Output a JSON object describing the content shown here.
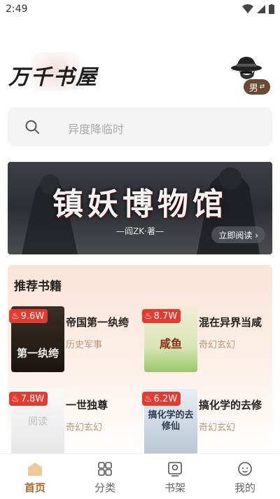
{
  "status_bar": {
    "time": "2:49"
  },
  "header": {
    "logo_text": "万千书屋",
    "gender_label": "男"
  },
  "search": {
    "placeholder": "异度降临时"
  },
  "banner": {
    "title": "镇妖博物馆",
    "author": "—阎ZK·著—",
    "read_button": "立即阅读 ›"
  },
  "recommend": {
    "title": "推荐书籍",
    "books": [
      {
        "name": "帝国第一纨绔",
        "genre": "历史军事",
        "heat": "9.6W",
        "cover_text": "第一纨绔"
      },
      {
        "name": "混在异界当咸",
        "genre": "奇幻玄幻",
        "heat": "8.7W",
        "cover_text": "咸鱼"
      },
      {
        "name": "一世独尊",
        "genre": "奇幻玄幻",
        "heat": "7.8W",
        "cover_text": "阅读"
      },
      {
        "name": "搞化学的去修",
        "genre": "奇幻玄幻",
        "heat": "6.2W",
        "cover_text": "搞化学的去修仙"
      }
    ]
  },
  "tabbar": {
    "tabs": [
      {
        "label": "首页",
        "active": true
      },
      {
        "label": "分类",
        "active": false
      },
      {
        "label": "书架",
        "active": false
      },
      {
        "label": "我的",
        "active": false
      }
    ]
  },
  "colors": {
    "accent": "#b26a2f",
    "badge_red": "#e53a2f",
    "genre_text": "#b9987c",
    "recommend_bg": "#fbe4d7"
  }
}
